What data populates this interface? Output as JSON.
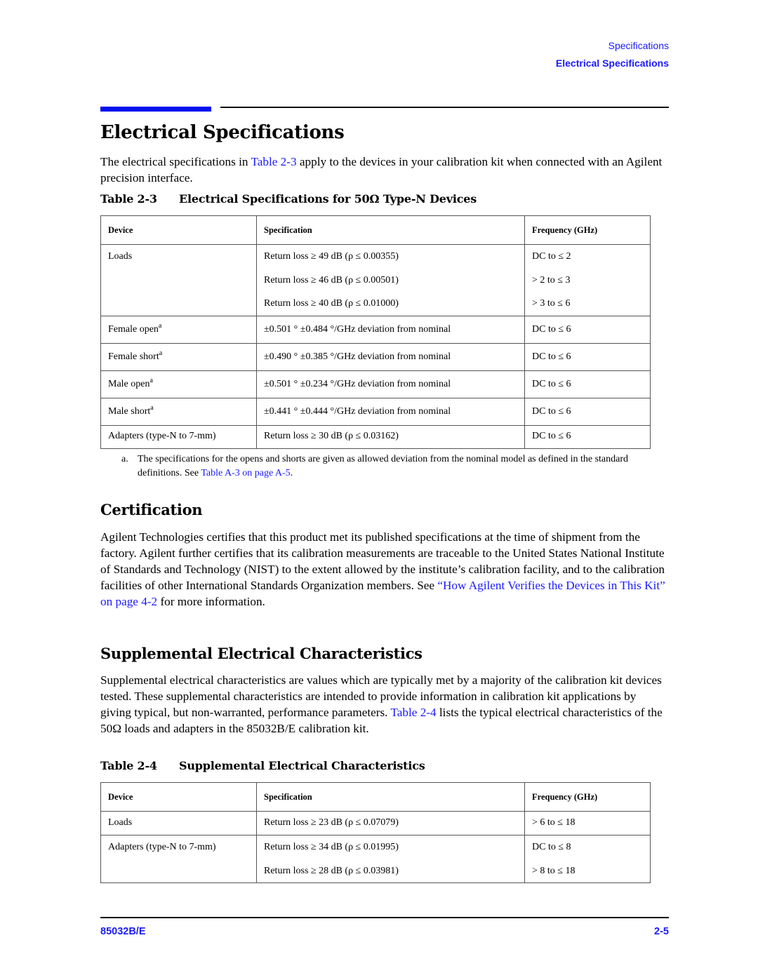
{
  "header": {
    "section": "Specifications",
    "subsection": "Electrical Specifications"
  },
  "title": "Electrical Specifications",
  "intro": {
    "before_link": "The electrical specifications in ",
    "link": "Table 2-3",
    "after_link": " apply to the devices in your calibration kit when connected with an Agilent precision interface."
  },
  "table1": {
    "number": "Table 2-3",
    "caption": "Electrical Specifications for 50Ω Type-N Devices",
    "columns": [
      "Device",
      "Specification",
      "Frequency (GHz)"
    ],
    "rows": [
      {
        "device": "Loads",
        "sup": "",
        "specs": [
          "Return loss ≥ 49 dB (ρ ≤ 0.00355)",
          "Return loss ≥ 46 dB (ρ ≤ 0.00501)",
          "Return loss ≥ 40 dB (ρ ≤ 0.01000)"
        ],
        "freqs": [
          "DC to ≤ 2",
          "> 2 to ≤ 3",
          "> 3 to ≤ 6"
        ]
      },
      {
        "device": "Female open",
        "sup": "a",
        "specs": [
          "±0.501 ° ±0.484 °/GHz deviation from nominal"
        ],
        "freqs": [
          "DC to ≤ 6"
        ]
      },
      {
        "device": "Female short",
        "sup": "a",
        "specs": [
          "±0.490 ° ±0.385 °/GHz deviation from nominal"
        ],
        "freqs": [
          "DC to ≤ 6"
        ]
      },
      {
        "device": "Male open",
        "sup": "a",
        "specs": [
          "±0.501 ° ±0.234 °/GHz deviation from nominal"
        ],
        "freqs": [
          "DC to ≤ 6"
        ]
      },
      {
        "device": "Male short",
        "sup": "a",
        "specs": [
          "±0.441 ° ±0.444 °/GHz deviation from nominal"
        ],
        "freqs": [
          "DC to ≤ 6"
        ]
      },
      {
        "device": "Adapters (type-N to 7-mm)",
        "sup": "",
        "specs": [
          "Return loss ≥ 30 dB (ρ ≤ 0.03162)"
        ],
        "freqs": [
          "DC to ≤ 6"
        ]
      }
    ],
    "footnote": {
      "label": "a.",
      "text": "The specifications for the opens and shorts are given as allowed deviation from the nominal model as defined in the standard definitions. See ",
      "link": "Table A-3 on page A-5",
      "after": "."
    }
  },
  "certification": {
    "heading": "Certification",
    "text": "Agilent Technologies certifies that this product met its published specifications at the time of shipment from the factory. Agilent further certifies that its calibration measurements are traceable to the United States National Institute of Standards and Technology (NIST) to the extent allowed by the institute’s calibration facility, and to the calibration facilities of other International Standards Organization members. See ",
    "link": "“How Agilent Verifies the Devices in This Kit” on page 4-2",
    "after": " for more information."
  },
  "supplemental": {
    "heading": "Supplemental Electrical Characteristics",
    "text": "Supplemental electrical characteristics are values which are typically met by a majority of the calibration kit devices tested. These supplemental characteristics are intended to provide information in calibration kit applications by giving typical, but non-warranted, performance parameters. ",
    "link": "Table 2-4",
    "after": " lists the typical electrical characteristics of the 50Ω loads and adapters in the 85032B/E calibration kit."
  },
  "table2": {
    "number": "Table 2-4",
    "caption": "Supplemental Electrical Characteristics",
    "columns": [
      "Device",
      "Specification",
      "Frequency (GHz)"
    ],
    "rows": [
      {
        "device": "Loads",
        "specs": [
          "Return loss ≥ 23 dB (ρ ≤ 0.07079)"
        ],
        "freqs": [
          "> 6 to ≤ 18"
        ]
      },
      {
        "device": "Adapters (type-N to 7-mm)",
        "specs": [
          "Return loss ≥ 34 dB (ρ ≤ 0.01995)",
          "Return loss ≥ 28 dB (ρ ≤ 0.03981)"
        ],
        "freqs": [
          "DC to ≤ 8",
          "> 8 to ≤ 18"
        ]
      }
    ]
  },
  "footer": {
    "model": "85032B/E",
    "page": "2-5"
  }
}
